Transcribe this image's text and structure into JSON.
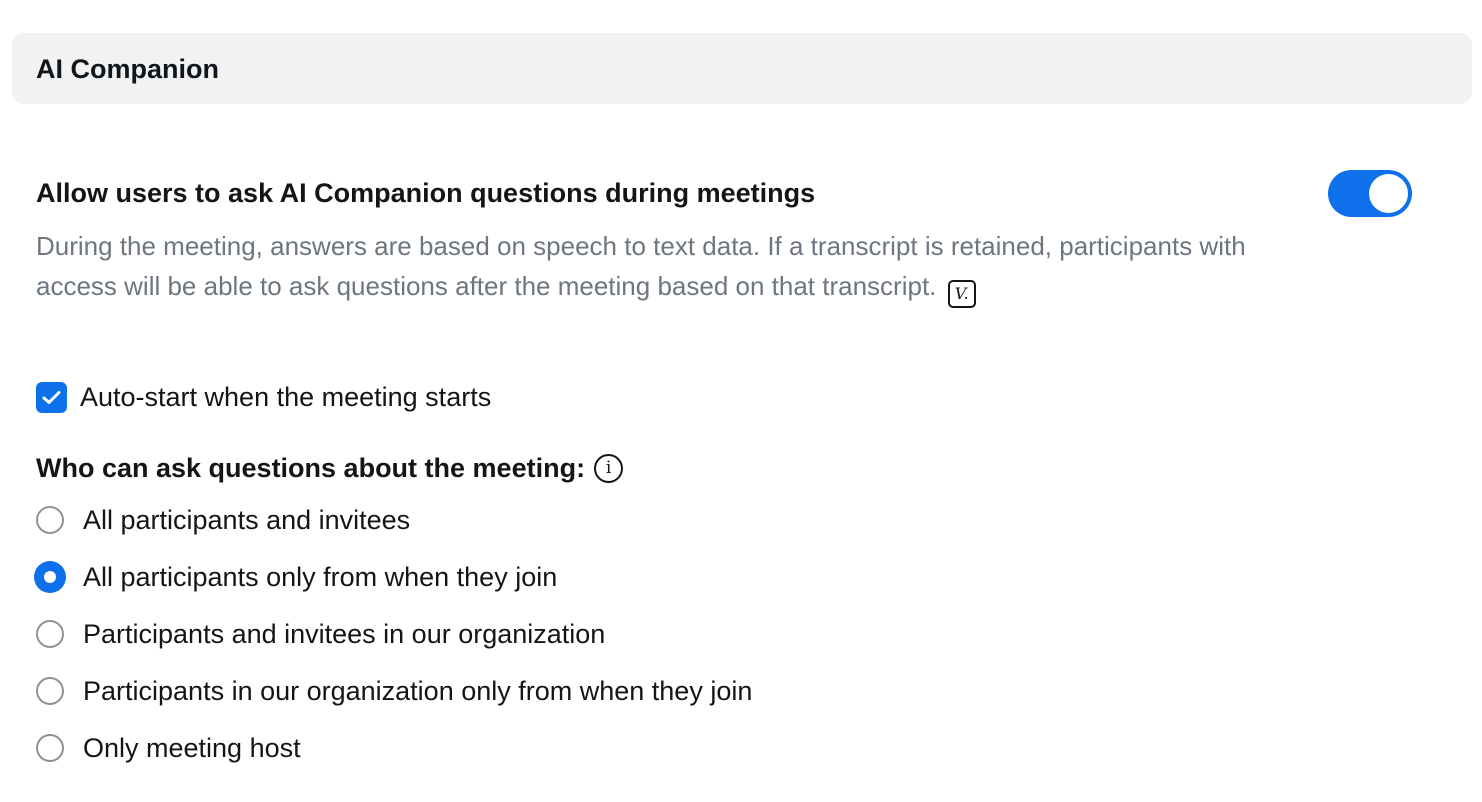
{
  "section": {
    "title": "AI Companion"
  },
  "setting": {
    "title": "Allow users to ask AI Companion questions during meetings",
    "enabled": true,
    "description": "During the meeting, answers are based on speech to text data. If a transcript is retained, participants with access will be able to ask questions after the meeting based on that transcript.",
    "badge_label": "V."
  },
  "auto_start": {
    "label": "Auto-start when the meeting starts",
    "checked": true
  },
  "who_can_ask": {
    "heading": "Who can ask questions about the meeting:",
    "info_icon": "i",
    "options": [
      {
        "label": "All participants and invitees",
        "selected": false
      },
      {
        "label": "All participants only from when they join",
        "selected": true
      },
      {
        "label": "Participants and invitees in our organization",
        "selected": false
      },
      {
        "label": "Participants in our organization only from when they join",
        "selected": false
      },
      {
        "label": "Only meeting host",
        "selected": false
      }
    ]
  },
  "colors": {
    "accent": "#0e71eb",
    "header_bg": "#f1f2f4",
    "description_text": "#6e7680",
    "radio_border": "#8b9299"
  }
}
